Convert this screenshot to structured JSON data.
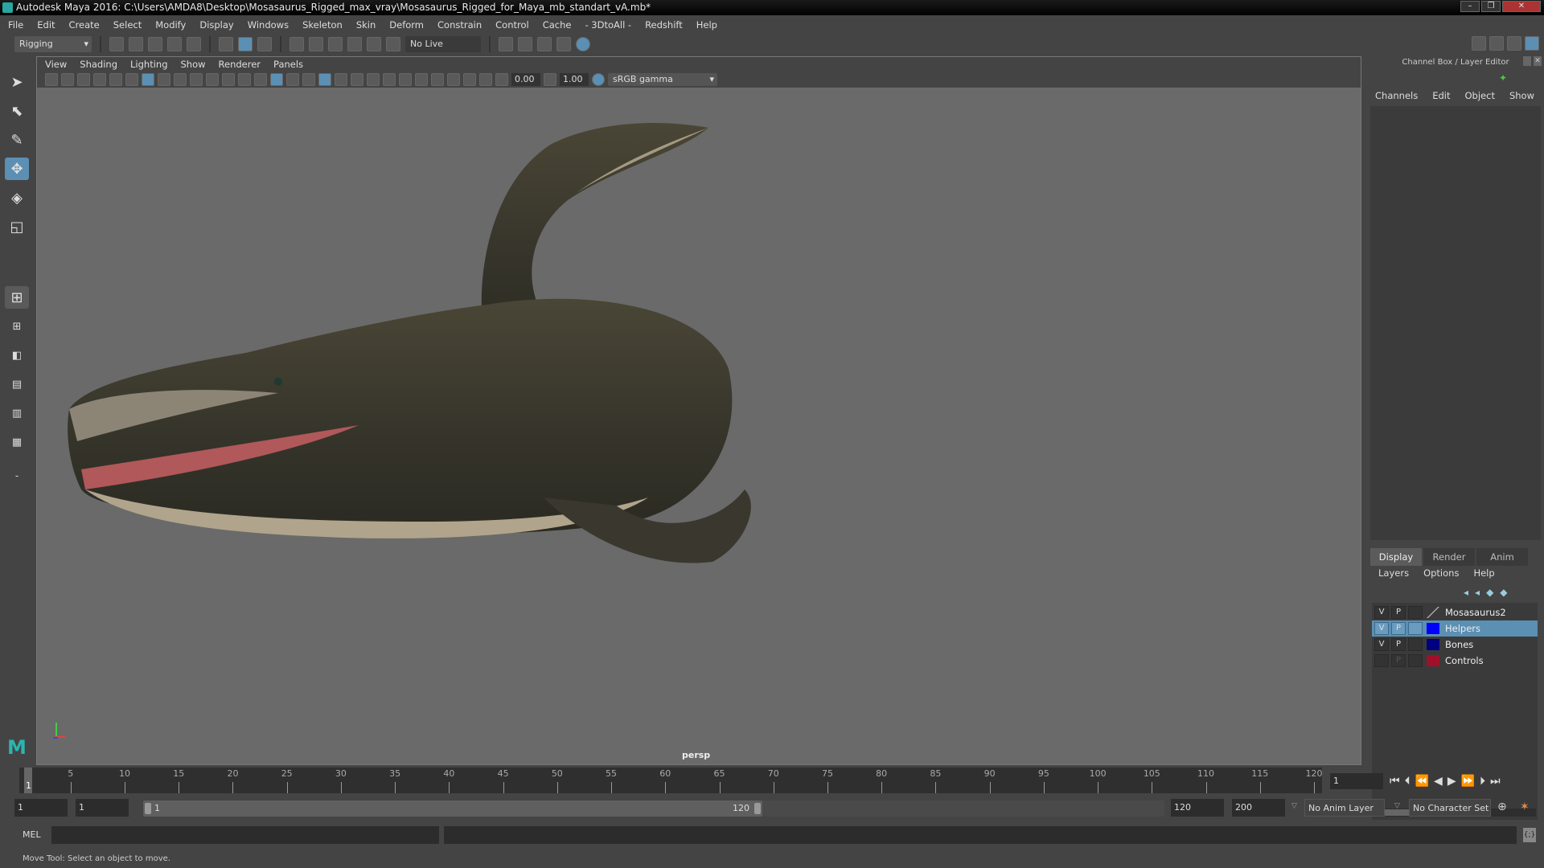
{
  "title": "Autodesk Maya 2016: C:\\Users\\AMDA8\\Desktop\\Mosasaurus_Rigged_max_vray\\Mosasaurus_Rigged_for_Maya_mb_standart_vA.mb*",
  "menu": [
    "File",
    "Edit",
    "Create",
    "Select",
    "Modify",
    "Display",
    "Windows",
    "Skeleton",
    "Skin",
    "Deform",
    "Constrain",
    "Control",
    "Cache",
    "- 3DtoAll -",
    "Redshift",
    "Help"
  ],
  "shelf": {
    "mode": "Rigging",
    "live_surface": "No Live Surface"
  },
  "panel_menu": [
    "View",
    "Shading",
    "Lighting",
    "Show",
    "Renderer",
    "Panels"
  ],
  "panel_toolbar": {
    "exposure": "0.00",
    "gamma": "1.00",
    "color_space": "sRGB gamma"
  },
  "viewport": {
    "camera_label": "persp"
  },
  "channel_box": {
    "title": "Channel Box / Layer Editor",
    "menu": [
      "Channels",
      "Edit",
      "Object",
      "Show"
    ]
  },
  "layer_editor": {
    "tabs": [
      "Display",
      "Render",
      "Anim"
    ],
    "menu": [
      "Layers",
      "Options",
      "Help"
    ],
    "layers": [
      {
        "v": "V",
        "p": "P",
        "name": "Mosasaurus2",
        "color": "none",
        "selected": false
      },
      {
        "v": "V",
        "p": "P",
        "name": "Helpers",
        "color": "#0000ff",
        "selected": true
      },
      {
        "v": "V",
        "p": "P",
        "name": "Bones",
        "color": "#000080",
        "selected": false
      },
      {
        "v": "",
        "p": "",
        "name": "Controls",
        "color": "#a0102a",
        "selected": false
      }
    ]
  },
  "timeline": {
    "ticks": [
      "5",
      "10",
      "15",
      "20",
      "25",
      "30",
      "35",
      "40",
      "45",
      "50",
      "55",
      "60",
      "65",
      "70",
      "75",
      "80",
      "85",
      "90",
      "95",
      "100",
      "105",
      "110",
      "115",
      "120"
    ],
    "current_frame_marker": "1",
    "current_frame": "1"
  },
  "range": {
    "start": "1",
    "playback_start": "1",
    "slider_start": "1",
    "slider_end": "120",
    "playback_end": "120",
    "end": "200",
    "anim_layer": "No Anim Layer",
    "character_set": "No Character Set"
  },
  "command": {
    "label": "MEL"
  },
  "help_line": "Move Tool: Select an object to move."
}
